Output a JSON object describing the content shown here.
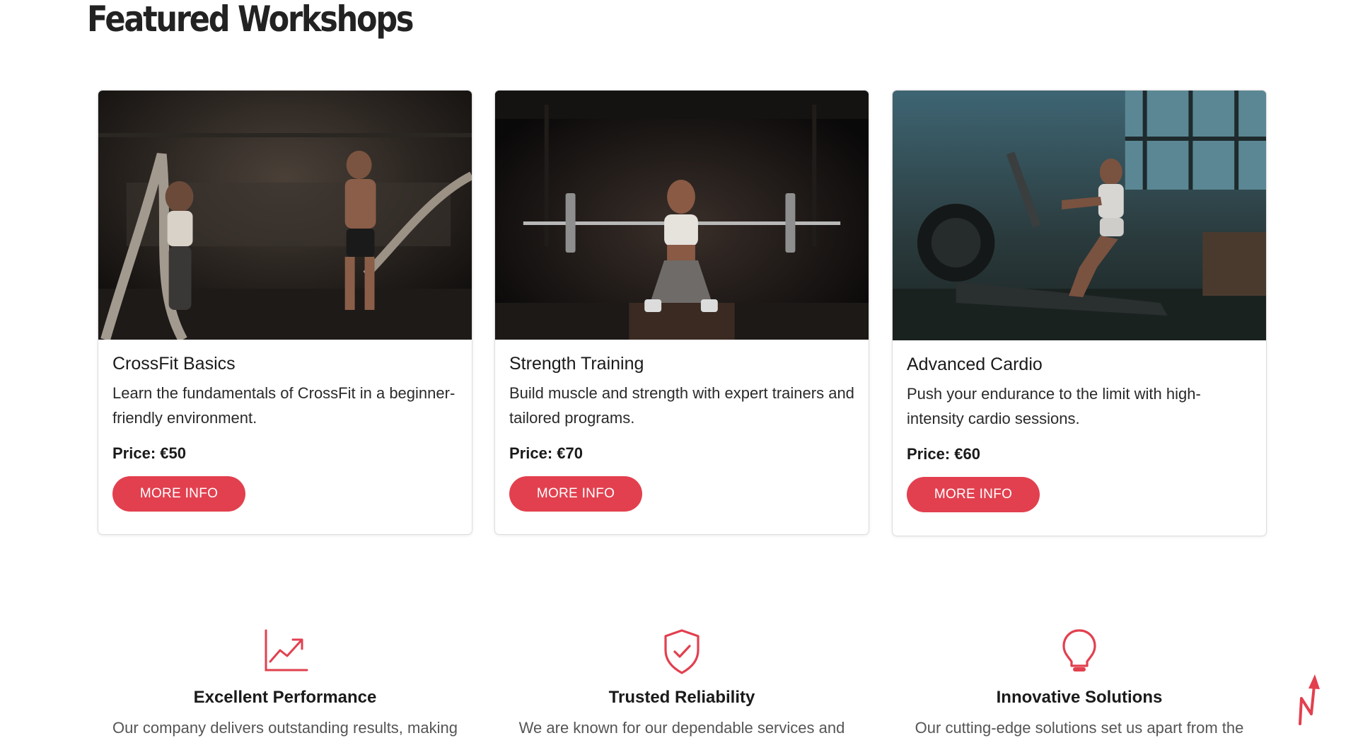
{
  "section": {
    "title": "Featured Workshops"
  },
  "workshops": [
    {
      "title": "CrossFit Basics",
      "description": "Learn the fundamentals of CrossFit in a beginner-friendly environment.",
      "price_label": "Price:",
      "price_value": "€50",
      "button_label": "MORE INFO",
      "image": "battle-ropes-photo"
    },
    {
      "title": "Strength Training",
      "description": "Build muscle and strength with expert trainers and tailored programs.",
      "price_label": "Price:",
      "price_value": "€70",
      "button_label": "MORE INFO",
      "image": "barbell-squat-photo"
    },
    {
      "title": "Advanced Cardio",
      "description": "Push your endurance to the limit with high-intensity cardio sessions.",
      "price_label": "Price:",
      "price_value": "€60",
      "button_label": "MORE INFO",
      "image": "rowing-machine-photo"
    }
  ],
  "features": [
    {
      "icon": "chart-trend-icon",
      "title": "Excellent Performance",
      "text": "Our company delivers outstanding results, making"
    },
    {
      "icon": "shield-check-icon",
      "title": "Trusted Reliability",
      "text": "We are known for our dependable services and"
    },
    {
      "icon": "lightbulb-icon",
      "title": "Innovative Solutions",
      "text": "Our cutting-edge solutions set us apart from the"
    }
  ],
  "colors": {
    "accent": "#e2404f",
    "text": "#1a1a1a",
    "muted": "#555555",
    "card_border": "#dcdcdc"
  },
  "back_to_top": {
    "icon": "back-to-top-arrow-icon"
  }
}
